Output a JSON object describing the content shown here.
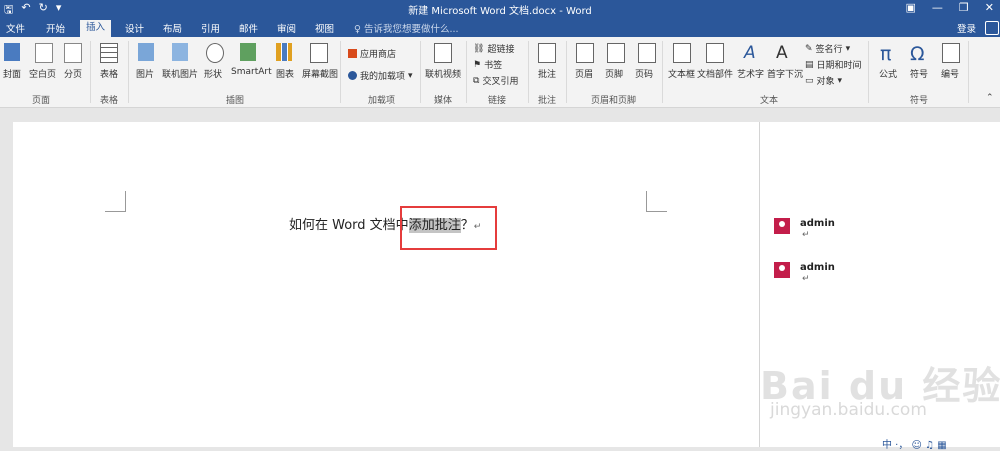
{
  "window": {
    "title": "新建 Microsoft Word 文档.docx - Word"
  },
  "quick_access": {
    "save_icon": "save-icon",
    "undo_icon": "undo-icon",
    "redo_icon": "redo-icon"
  },
  "tabs": [
    {
      "label": "文件"
    },
    {
      "label": "开始"
    },
    {
      "label": "插入"
    },
    {
      "label": "设计"
    },
    {
      "label": "布局"
    },
    {
      "label": "引用"
    },
    {
      "label": "邮件"
    },
    {
      "label": "审阅"
    },
    {
      "label": "视图"
    }
  ],
  "tell_me": "告诉我您想要做什么...",
  "login": "登录",
  "ribbon": {
    "buttons": {
      "cover": "封面",
      "blank_page": "空白页",
      "page_break": "分页",
      "table": "表格",
      "picture": "图片",
      "online_picture": "联机图片",
      "shapes": "形状",
      "smartart": "SmartArt",
      "chart": "图表",
      "screenshot": "屏幕截图",
      "store": "应用商店",
      "my_addins": "我的加载项",
      "online_video": "联机视频",
      "hyperlink": "超链接",
      "bookmark": "书签",
      "cross_ref": "交叉引用",
      "comment": "批注",
      "header": "页眉",
      "footer": "页脚",
      "page_number": "页码",
      "textbox": "文本框",
      "quick_parts": "文档部件",
      "wordart": "艺术字",
      "dropcap": "首字下沉",
      "signature": "签名行",
      "datetime": "日期和时间",
      "object": "对象",
      "equation": "公式",
      "symbol": "符号",
      "numbering": "编号"
    },
    "groups": {
      "pages": "页面",
      "tables": "表格",
      "illustrations": "插图",
      "addins": "加载项",
      "media": "媒体",
      "links": "链接",
      "comments": "批注",
      "header_footer": "页眉和页脚",
      "text": "文本",
      "symbols": "符号"
    }
  },
  "document": {
    "text_before": "如何在 Word 文档中",
    "text_highlight": "添加批注",
    "text_after": "？",
    "para_mark": "↵"
  },
  "comments": [
    {
      "author": "admin",
      "para_mark": "↵"
    },
    {
      "author": "admin",
      "para_mark": "↵"
    }
  ],
  "watermark": {
    "logo": "Bai du 经验",
    "url": "jingyan.baidu.com"
  },
  "tray": {
    "text": "中 ·， ☺ ♫ ▦"
  },
  "colors": {
    "title_bar": "#2b579a",
    "ribbon": "#f3f3f3",
    "comment_avatar": "#c31d4a",
    "highlight_box": "#e53c3c"
  }
}
